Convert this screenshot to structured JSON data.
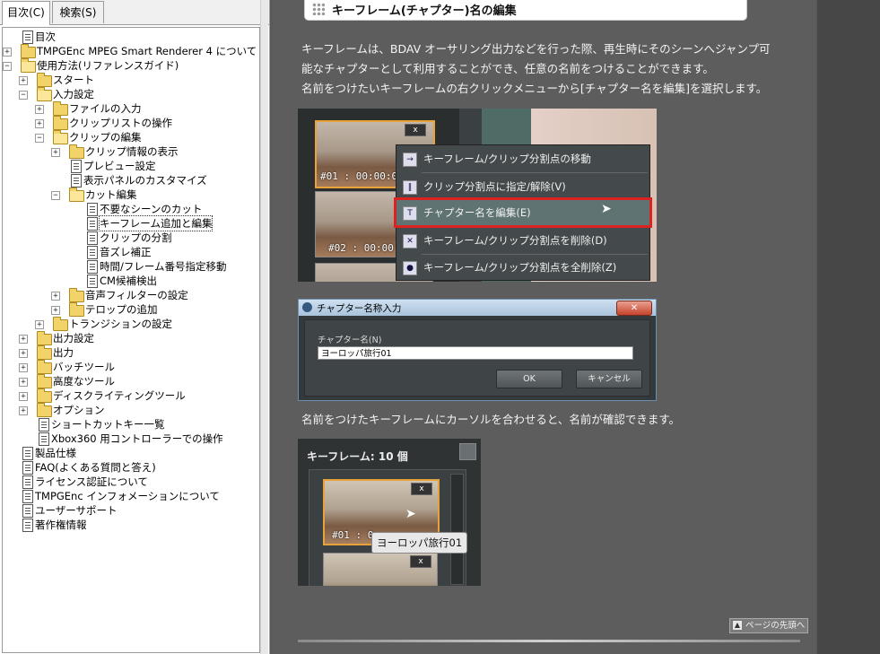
{
  "tabs": [
    {
      "label": "目次(C)"
    },
    {
      "label": "検索(S)"
    }
  ],
  "tree": [
    {
      "label": "目次",
      "kind": "page",
      "level": 0
    },
    {
      "label": "TMPGEnc MPEG Smart Renderer 4 について",
      "kind": "folder",
      "level": 0,
      "exp": "+"
    },
    {
      "label": "使用方法(リファレンスガイド)",
      "kind": "folder-open",
      "level": 0,
      "exp": "-"
    },
    {
      "label": "スタート",
      "kind": "folder",
      "level": 1,
      "exp": "+"
    },
    {
      "label": "入力設定",
      "kind": "folder-open",
      "level": 1,
      "exp": "-"
    },
    {
      "label": "ファイルの入力",
      "kind": "folder",
      "level": 2,
      "exp": "+"
    },
    {
      "label": "クリップリストの操作",
      "kind": "folder",
      "level": 2,
      "exp": "+"
    },
    {
      "label": "クリップの編集",
      "kind": "folder-open",
      "level": 2,
      "exp": "-"
    },
    {
      "label": "クリップ情報の表示",
      "kind": "folder",
      "level": 3,
      "exp": "+"
    },
    {
      "label": "プレビュー設定",
      "kind": "page",
      "level": 3
    },
    {
      "label": "表示パネルのカスタマイズ",
      "kind": "page",
      "level": 3
    },
    {
      "label": "カット編集",
      "kind": "folder-open",
      "level": 3,
      "exp": "-"
    },
    {
      "label": "不要なシーンのカット",
      "kind": "page",
      "level": 4
    },
    {
      "label": "キーフレーム追加と編集",
      "kind": "page",
      "level": 4,
      "selected": true
    },
    {
      "label": "クリップの分割",
      "kind": "page",
      "level": 4
    },
    {
      "label": "音ズレ補正",
      "kind": "page",
      "level": 4
    },
    {
      "label": "時間/フレーム番号指定移動",
      "kind": "page",
      "level": 4
    },
    {
      "label": "CM候補検出",
      "kind": "page",
      "level": 4
    },
    {
      "label": "音声フィルターの設定",
      "kind": "folder",
      "level": 3,
      "exp": "+"
    },
    {
      "label": "テロップの追加",
      "kind": "folder",
      "level": 3,
      "exp": "+"
    },
    {
      "label": "トランジションの設定",
      "kind": "folder",
      "level": 2,
      "exp": "+"
    },
    {
      "label": "出力設定",
      "kind": "folder",
      "level": 1,
      "exp": "+"
    },
    {
      "label": "出力",
      "kind": "folder",
      "level": 1,
      "exp": "+"
    },
    {
      "label": "バッチツール",
      "kind": "folder",
      "level": 1,
      "exp": "+"
    },
    {
      "label": "高度なツール",
      "kind": "folder",
      "level": 1,
      "exp": "+"
    },
    {
      "label": "ディスクライティングツール",
      "kind": "folder",
      "level": 1,
      "exp": "+"
    },
    {
      "label": "オプション",
      "kind": "folder",
      "level": 1,
      "exp": "+"
    },
    {
      "label": "ショートカットキー一覧",
      "kind": "page",
      "level": 1
    },
    {
      "label": "Xbox360 用コントローラーでの操作",
      "kind": "page",
      "level": 1
    },
    {
      "label": "製品仕様",
      "kind": "page",
      "level": 0
    },
    {
      "label": "FAQ(よくある質問と答え)",
      "kind": "page",
      "level": 0
    },
    {
      "label": "ライセンス認証について",
      "kind": "page",
      "level": 0
    },
    {
      "label": "TMPGEnc インフォメーションについて",
      "kind": "page",
      "level": 0
    },
    {
      "label": "ユーザーサポート",
      "kind": "page",
      "level": 0
    },
    {
      "label": "著作権情報",
      "kind": "page",
      "level": 0
    }
  ],
  "page": {
    "heading": "キーフレーム(チャプター)名の編集",
    "para1_line1": "キーフレームは、BDAV オーサリング出力などを行った際、再生時にそのシーンへジャンプ可",
    "para1_line2": "能なチャプターとして利用することができ、任意の名前をつけることができます。",
    "para1_line3": "名前をつけたいキーフレームの右クリックメニューから[チャプター名を編集]を選択します。",
    "para2": "名前をつけたキーフレームにカーソルを合わせると、名前が確認できます。",
    "top_link": "ページの先頭へ"
  },
  "shot1": {
    "timecode1": "#01 : 00:00:0",
    "timecode2": "#02 : 00:00",
    "x_label": "x",
    "menu": [
      {
        "label": "キーフレーム/クリップ分割点の移動",
        "icon": "→"
      },
      {
        "label": "クリップ分割点に指定/解除(V)",
        "icon": "‖"
      },
      {
        "label": "チャプター名を編集(E)",
        "icon": "T"
      },
      {
        "label": "キーフレーム/クリップ分割点を削除(D)",
        "icon": "✕"
      },
      {
        "label": "キーフレーム/クリップ分割点を全削除(Z)",
        "icon": "●"
      }
    ]
  },
  "dialog": {
    "title": "チャプター名称入力",
    "close": "✕",
    "label": "チャプター名(N)",
    "value": "ヨーロッパ旅行01",
    "ok": "OK",
    "cancel": "キャンセル"
  },
  "shot3": {
    "header": "キーフレーム: 10 個",
    "timecode": "#01 : 0",
    "x_label": "x",
    "tooltip": "ヨーロッパ旅行01"
  },
  "colors": {
    "highlight_outline": "#d22222",
    "content_bg": "#5d5d5d",
    "selected_thumb_border": "#e7a23a"
  }
}
